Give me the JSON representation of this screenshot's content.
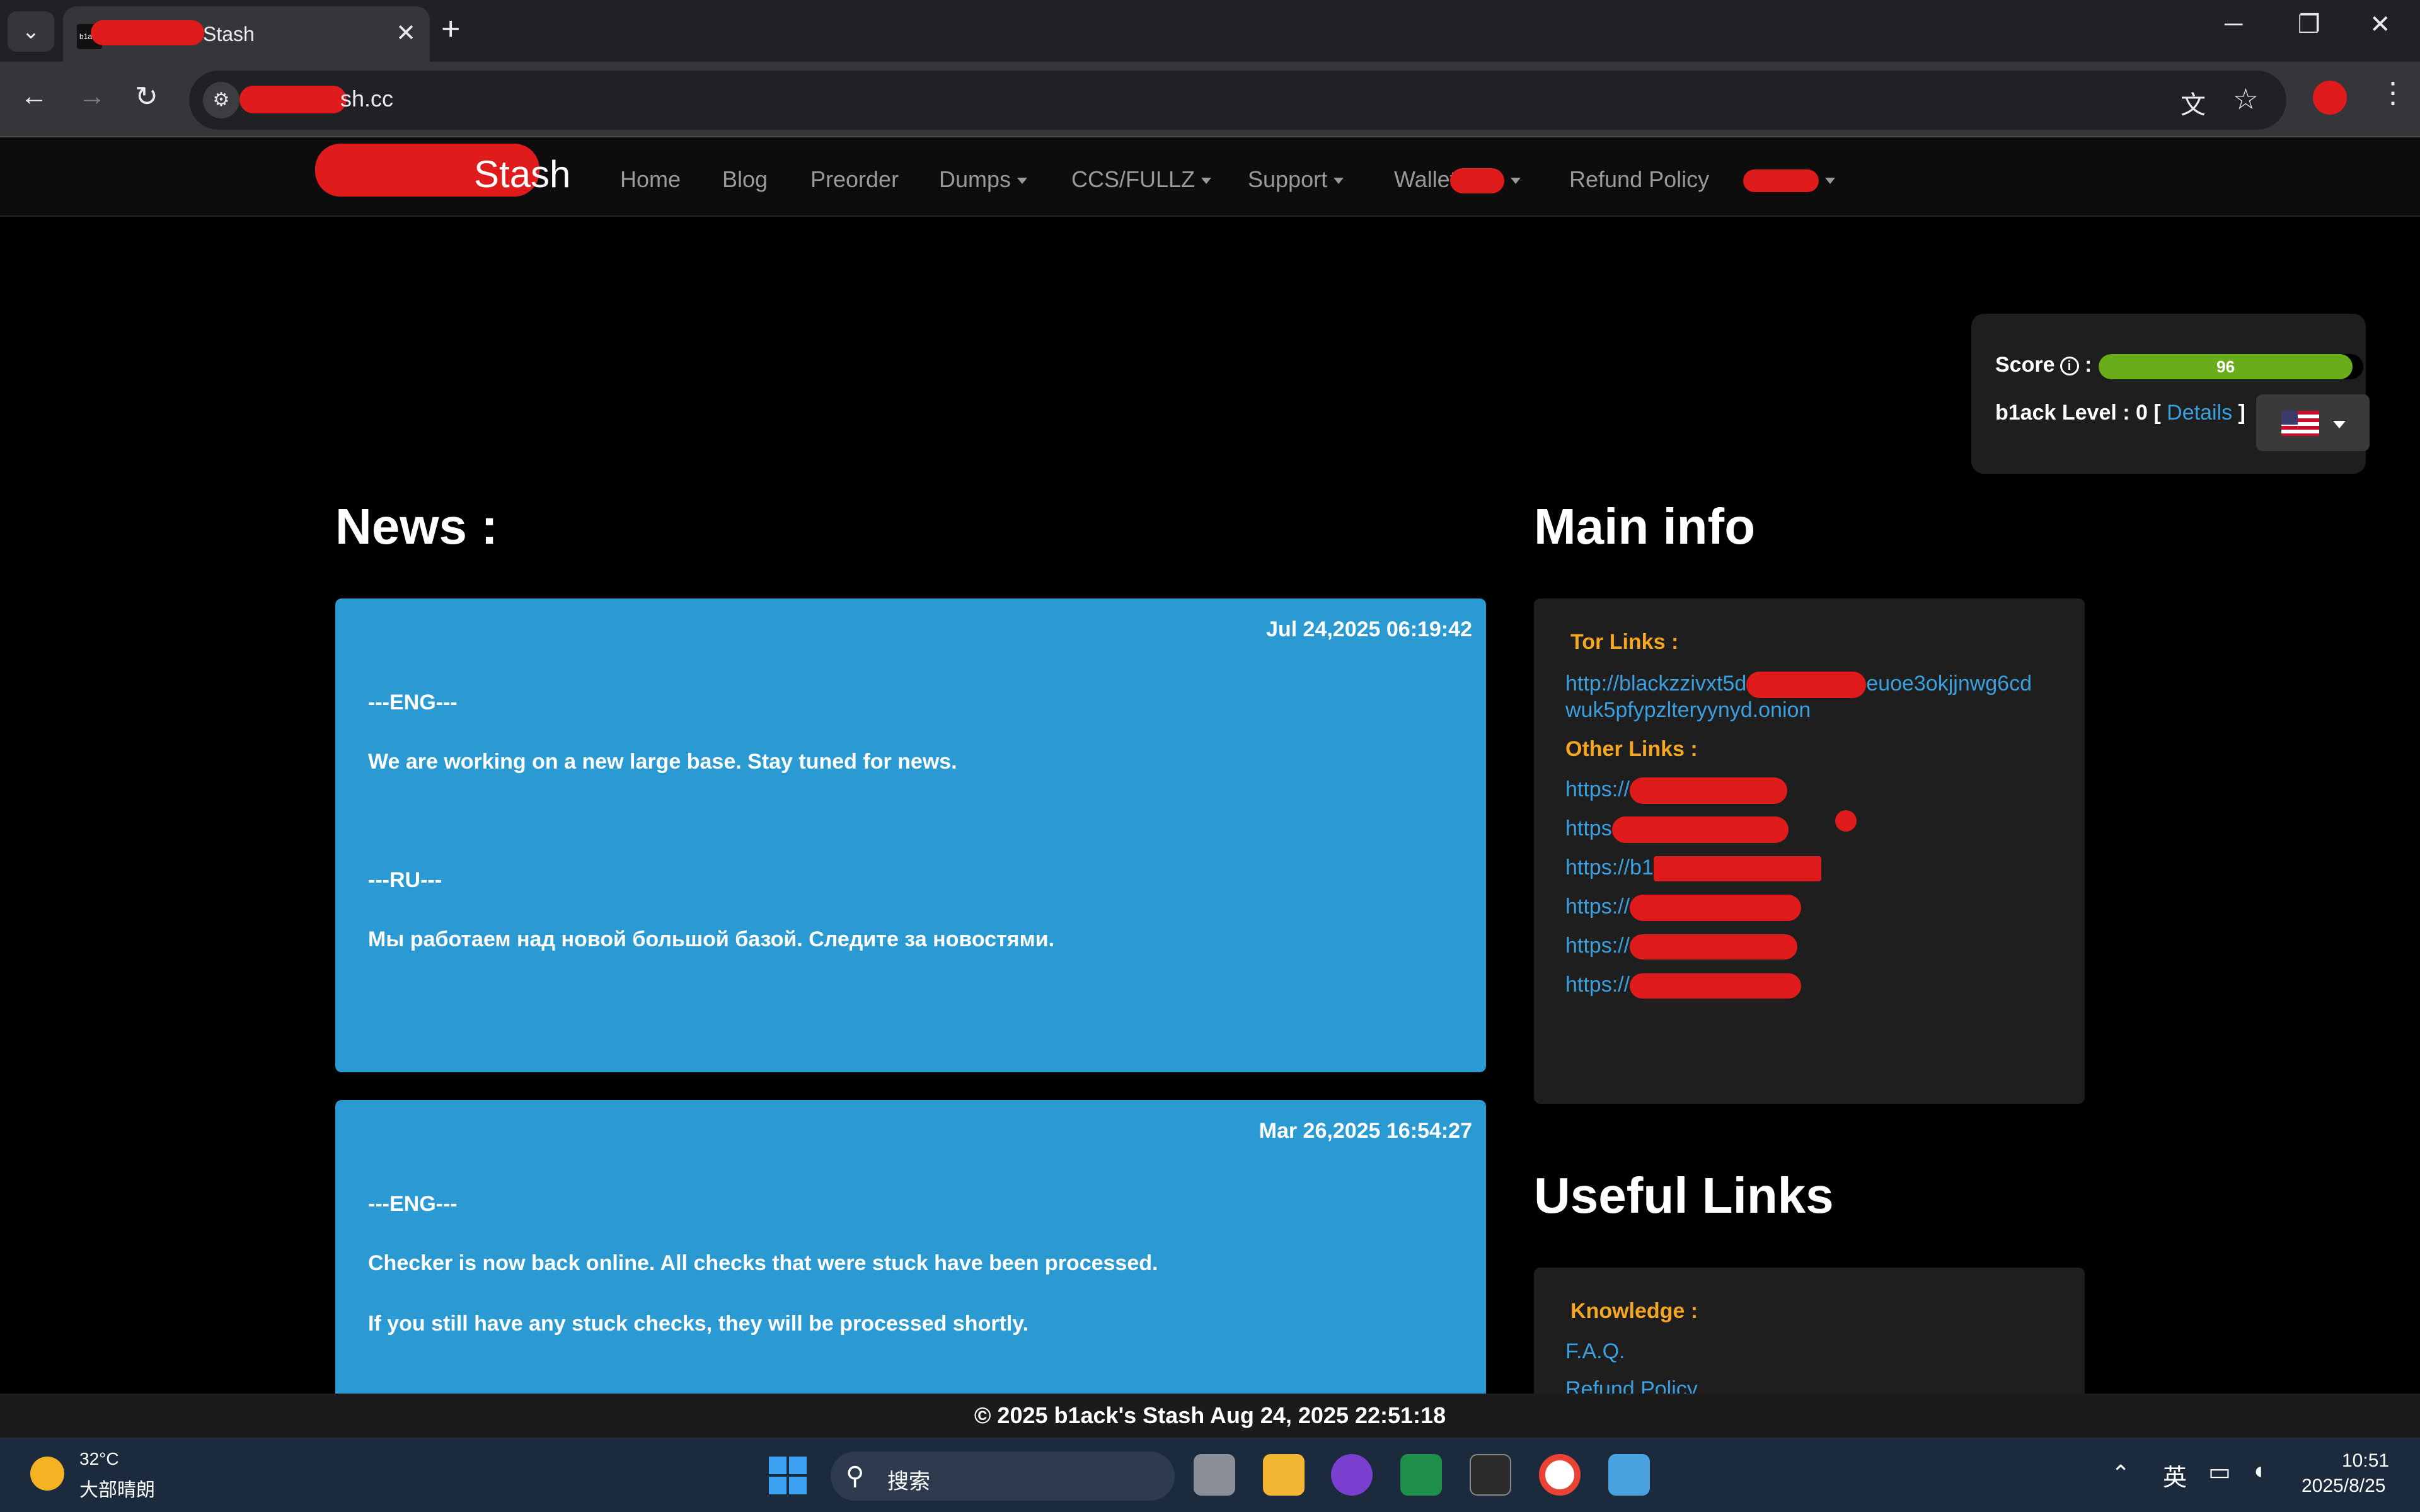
{
  "browser": {
    "tab_title": "Stash",
    "favicon_text": "b1ack",
    "new_tab": "+",
    "url": "sh.cc",
    "window": {
      "minimize": "─",
      "restore": "❐",
      "close": "✕"
    }
  },
  "site": {
    "brand": "Stash",
    "nav": [
      {
        "label": "Home"
      },
      {
        "label": "Blog"
      },
      {
        "label": "Preorder"
      },
      {
        "label": "Dumps"
      },
      {
        "label": "CCS/FULLZ"
      },
      {
        "label": "Support"
      },
      {
        "label": "Wallet"
      },
      {
        "label": "Refund Policy"
      }
    ]
  },
  "score_panel": {
    "score_label": "Score",
    "info_icon": "i",
    "score_value": "96",
    "score_percent": 96,
    "level_prefix": "b1ack Level : 0 [ ",
    "details_link": "Details",
    "level_suffix": " ]",
    "language_icon": "us-flag-icon"
  },
  "news": {
    "heading": "News :",
    "posts": [
      {
        "date": "Jul 24,2025 06:19:42",
        "lines": [
          "---ENG---",
          "We are working on a new large base. Stay tuned for news.",
          "---RU---",
          "Мы работаем над новой большой базой. Следите за новостями."
        ]
      },
      {
        "date": "Mar 26,2025 16:54:27",
        "lines": [
          "---ENG---",
          "Checker is now back online. All checks that were stuck have been processed.",
          "If you still have any stuck checks, they will be processed shortly."
        ]
      }
    ]
  },
  "main_info": {
    "heading": "Main info",
    "tor_label": "Tor Links :",
    "tor_link_line1": "http://blackzzivxt5d",
    "tor_link_line1_end": "euoe3okjjnwg6cd",
    "tor_link_line2": "wuk5pfypzlteryynyd.onion",
    "other_label": "Other Links :",
    "other_links": [
      "https://",
      "https",
      "https://b1",
      "https://",
      "https://",
      "https://"
    ]
  },
  "useful_links": {
    "heading": "Useful Links",
    "knowledge_label": "Knowledge :",
    "links": [
      "F.A.Q.",
      "Refund Policy"
    ]
  },
  "footer": {
    "text": "© 2025 b1ack's Stash Aug 24, 2025 22:51:18"
  },
  "taskbar": {
    "temperature": "32°C",
    "weather": "大部晴朗",
    "search_placeholder": "搜索",
    "ime": "英",
    "time": "10:51",
    "date": "2025/8/25"
  }
}
